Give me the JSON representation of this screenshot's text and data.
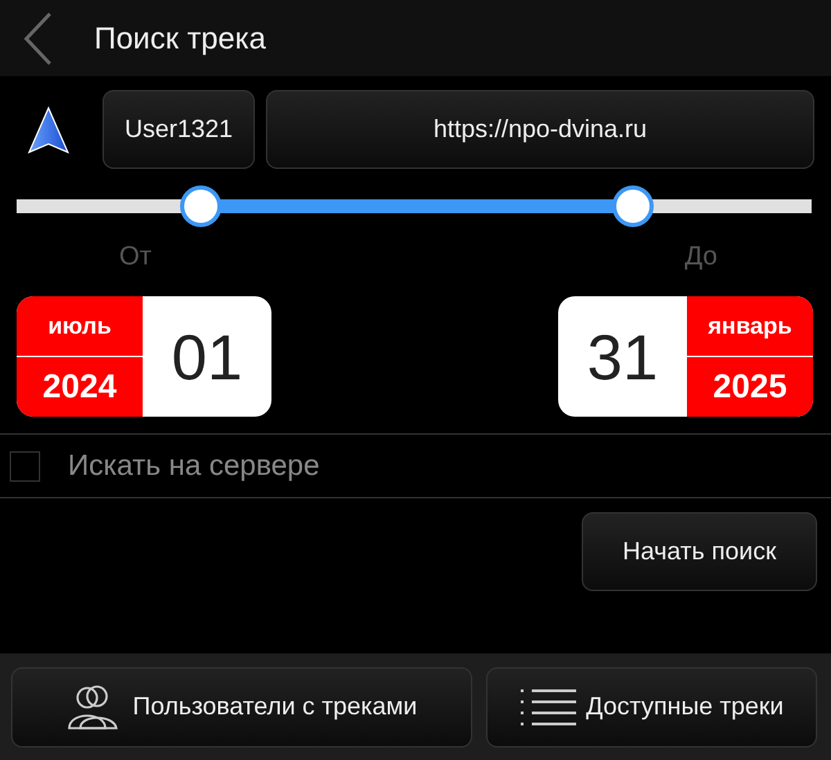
{
  "header": {
    "title": "Поиск трека"
  },
  "account": {
    "user": "User1321",
    "server": "https://npo-dvina.ru"
  },
  "slider": {
    "thumbs": [
      {
        "level": 0.232
      },
      {
        "level": 0.775
      }
    ]
  },
  "range_labels": [
    "От",
    "До"
  ],
  "dates": [
    {
      "kind": "from",
      "month": "июль",
      "year": "2024",
      "day": "01"
    },
    {
      "kind": "to",
      "month": "январь",
      "year": "2025",
      "day": "31"
    }
  ],
  "server_search": {
    "label": "Искать на сервере",
    "checked": false
  },
  "search_button": "Начать поиск",
  "footer": [
    {
      "kind": "users",
      "label": "Пользователи с треками"
    },
    {
      "kind": "list",
      "label": "Доступные треки"
    }
  ]
}
